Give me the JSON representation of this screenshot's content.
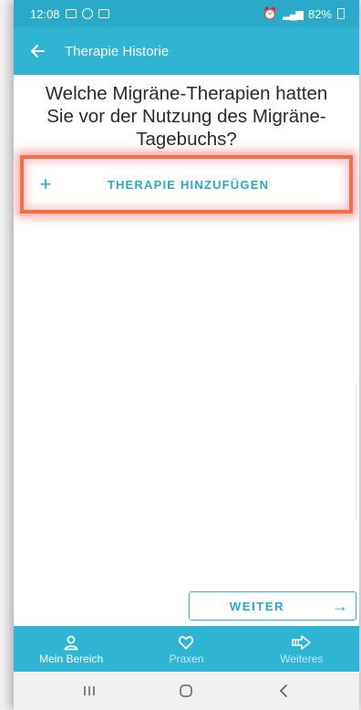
{
  "status_bar": {
    "time": "12:08",
    "battery": "82%"
  },
  "app_bar": {
    "title": "Therapie Historie"
  },
  "question": {
    "text": "Welche Migräne-Therapien hatten Sie vor der Nutzung des Migräne-Tagebuchs?"
  },
  "add_button": {
    "icon": "+",
    "label": "THERAPIE HINZUFÜGEN"
  },
  "next_button": {
    "label": "WEITER",
    "icon": "→"
  },
  "bottom_nav": {
    "items": [
      {
        "label": "Mein Bereich",
        "icon": "person-icon",
        "active": true
      },
      {
        "label": "Praxen",
        "icon": "heart-icon",
        "active": false
      },
      {
        "label": "Weiteres",
        "icon": "arrow-right-outline-icon",
        "active": false
      }
    ]
  },
  "colors": {
    "primary": "#2fb5d3",
    "highlight": "#f07048"
  }
}
